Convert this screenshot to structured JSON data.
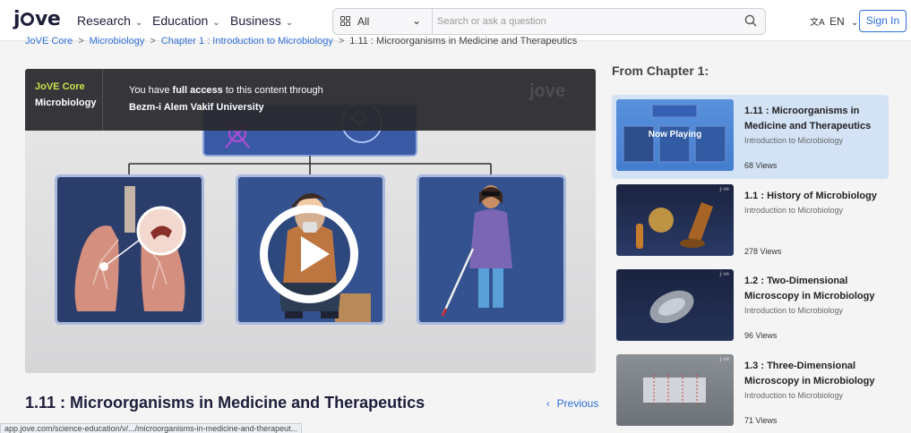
{
  "header": {
    "logo": "jove",
    "nav": [
      {
        "label": "Research"
      },
      {
        "label": "Education"
      },
      {
        "label": "Business"
      }
    ],
    "search": {
      "scope": "All",
      "placeholder": "Search or ask a question"
    },
    "language": "EN",
    "signin_label": "Sign In"
  },
  "breadcrumb": {
    "items": [
      "JoVE Core",
      "Microbiology",
      "Chapter 1 : Introduction to Microbiology",
      "1.11 : Microorganisms in Medicine and Therapeutics"
    ]
  },
  "video": {
    "tag_line1": "JoVE Core",
    "tag_line2": "Microbiology",
    "access_prefix": "You have ",
    "access_bold": "full access",
    "access_suffix": " to this content through",
    "institution": "Bezm-i Alem Vakif University",
    "watermark": "jove"
  },
  "page_title": "1.11 : Microorganisms in Medicine and Therapeutics",
  "previous_label": "Previous",
  "status_url": "app.jove.com/science-education/v/.../microorganisms-in-medicine-and-therapeut...",
  "sidebar": {
    "title": "From Chapter 1:",
    "items": [
      {
        "title_line1": "1.11 : Microorganisms in",
        "title_line2": "Medicine and Therapeutics",
        "subtitle": "Introduction to Microbiology",
        "views": "68 Views",
        "badge": "Now Playing",
        "active": true
      },
      {
        "title_line1": "1.1 : History of Microbiology",
        "title_line2": "",
        "subtitle": "Introduction to Microbiology",
        "views": "278 Views",
        "active": false
      },
      {
        "title_line1": "1.2 : Two-Dimensional",
        "title_line2": "Microscopy in Microbiology",
        "subtitle": "Introduction to Microbiology",
        "views": "96 Views",
        "active": false
      },
      {
        "title_line1": "1.3 : Three-Dimensional",
        "title_line2": "Microscopy in Microbiology",
        "subtitle": "Introduction to Microbiology",
        "views": "71 Views",
        "active": false
      }
    ]
  },
  "colors": {
    "accent": "#2f6fd6",
    "active_card": "#d3e3f5",
    "tag_green": "#c9e34a"
  }
}
